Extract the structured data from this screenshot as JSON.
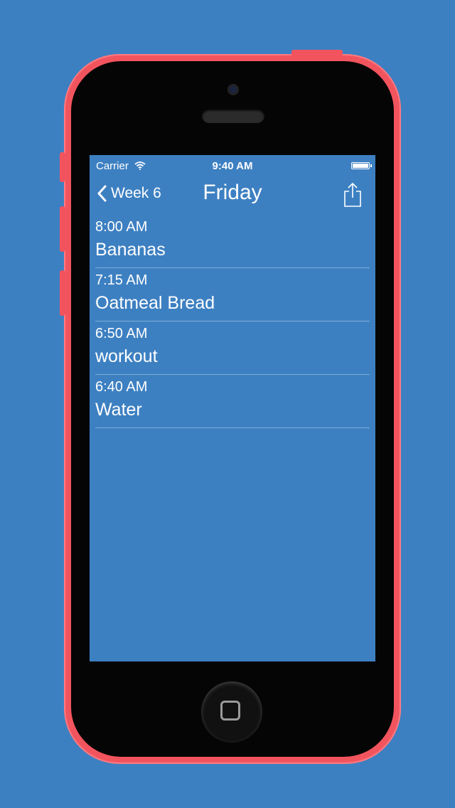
{
  "status_bar": {
    "carrier": "Carrier",
    "time": "9:40 AM"
  },
  "nav": {
    "back_label": "Week 6",
    "title": "Friday"
  },
  "entries": [
    {
      "time": "8:00 AM",
      "name": "Bananas"
    },
    {
      "time": "7:15 AM",
      "name": "Oatmeal Bread"
    },
    {
      "time": "6:50 AM",
      "name": "workout"
    },
    {
      "time": "6:40 AM",
      "name": "Water"
    }
  ],
  "icons": {
    "back": "chevron-left-icon",
    "share": "share-icon",
    "wifi": "wifi-icon",
    "battery": "battery-icon"
  },
  "colors": {
    "background": "#3d80c2",
    "phone_body": "#f2545e",
    "text": "#ffffff"
  }
}
